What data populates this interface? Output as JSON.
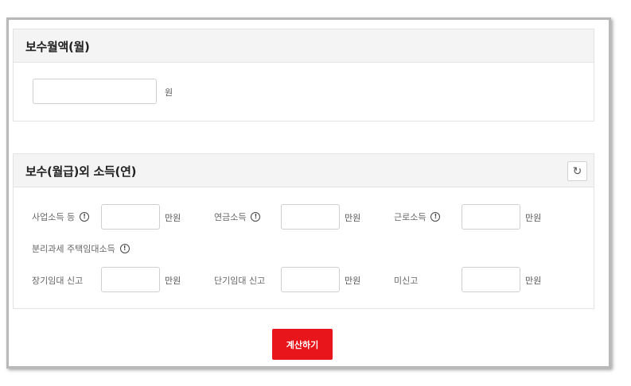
{
  "monthly_pay": {
    "title": "보수월액(월)",
    "input_value": "",
    "unit": "원"
  },
  "other_income": {
    "title": "보수(월급)외 소득(연)",
    "reset_icon": "↻",
    "info_icon": "!",
    "fields": [
      {
        "label": "사업소득 등",
        "value": "",
        "unit": "만원"
      },
      {
        "label": "연금소득",
        "value": "",
        "unit": "만원"
      },
      {
        "label": "근로소득",
        "value": "",
        "unit": "만원"
      }
    ],
    "rental_title": "분리과세 주택임대소득",
    "rental_fields": [
      {
        "label": "장기임대 신고",
        "value": "",
        "unit": "만원"
      },
      {
        "label": "단기임대 신고",
        "value": "",
        "unit": "만원"
      },
      {
        "label": "미신고",
        "value": "",
        "unit": "만원"
      }
    ]
  },
  "calculate_button": "계산하기"
}
